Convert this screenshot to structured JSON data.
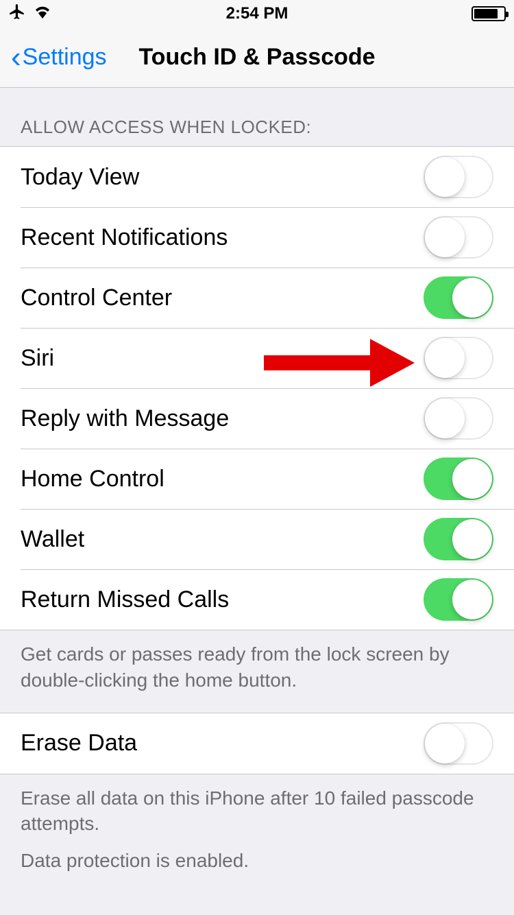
{
  "status_bar": {
    "time": "2:54 PM"
  },
  "nav": {
    "back_label": "Settings",
    "title": "Touch ID & Passcode"
  },
  "section1": {
    "header": "ALLOW ACCESS WHEN LOCKED:",
    "items": [
      {
        "label": "Today View",
        "on": false
      },
      {
        "label": "Recent Notifications",
        "on": false
      },
      {
        "label": "Control Center",
        "on": true
      },
      {
        "label": "Siri",
        "on": false
      },
      {
        "label": "Reply with Message",
        "on": false
      },
      {
        "label": "Home Control",
        "on": true
      },
      {
        "label": "Wallet",
        "on": true
      },
      {
        "label": "Return Missed Calls",
        "on": true
      }
    ],
    "footer": "Get cards or passes ready from the lock screen by double-clicking the home button."
  },
  "section2": {
    "items": [
      {
        "label": "Erase Data",
        "on": false
      }
    ],
    "footer1": "Erase all data on this iPhone after 10 failed passcode attempts.",
    "footer2": "Data protection is enabled."
  }
}
